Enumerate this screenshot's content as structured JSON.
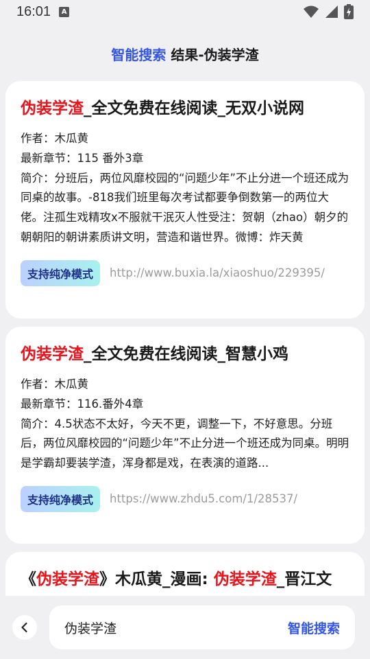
{
  "status": {
    "time": "16:01",
    "a_icon": "A"
  },
  "header": {
    "prefix": "智能搜索",
    "suffix": " 结果-伪装学渣"
  },
  "results": [
    {
      "title_hl": "伪装学渣",
      "title_rest": "_全文免费在线阅读_无双小说网",
      "author": "作者：木瓜黄",
      "latest": "最新章节：115 番外3章",
      "summary": "简介：分班后，两位风靡校园的“问题少年”不止分进一个班还成为同桌的故事。-818我们班里每次考试都要争倒数第一的两位大佬。注孤生戏精攻x不服就干泯灭人性受注：贺朝（zhao）朝夕的朝朝阳的朝讲素质讲文明，营造和谐世界。微博：炸天黄",
      "badge": "支持纯净模式",
      "url": "http://www.buxia.la/xiaoshuo/229395/"
    },
    {
      "title_hl": "伪装学渣",
      "title_rest": "_全文免费在线阅读_智慧小鸡",
      "author": "作者：木瓜黄",
      "latest": "最新章节：116.番外4章",
      "summary": "简介：4.5状态不太好，今天不更，调整一下，不好意思。分班后，两位风靡校园的“问题少年”不止分进一个班还成为同桌。明明是学霸却要装学渣，浑身都是戏，在表演的道路...",
      "badge": "支持纯净模式",
      "url": "https://www.zhdu5.com/1/28537/"
    },
    {
      "title_a": "《",
      "title_hl": "伪装学渣",
      "title_b": "》木瓜黄_漫画: ",
      "title_hl2": "伪装学渣",
      "title_c": "_晋江文"
    }
  ],
  "search": {
    "value": "伪装学渣",
    "button": "智能搜索"
  }
}
